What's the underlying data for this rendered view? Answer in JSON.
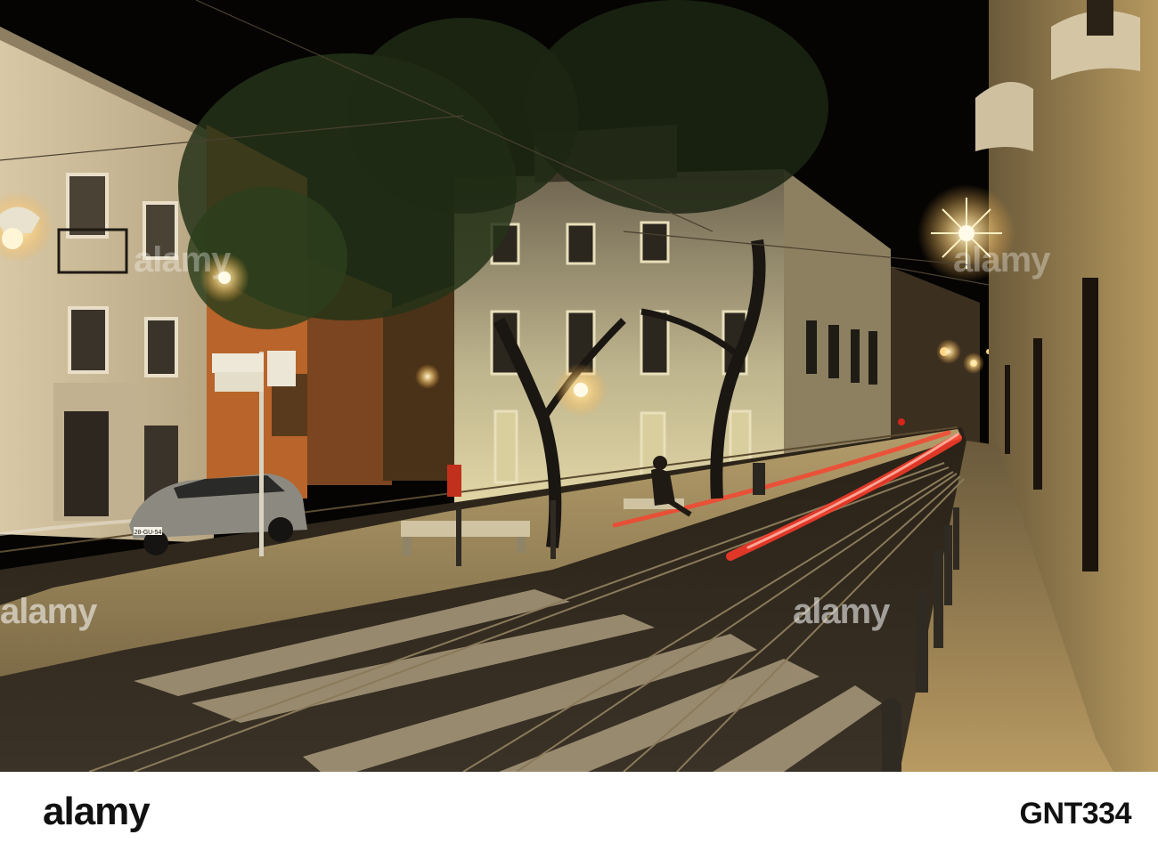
{
  "photo": {
    "watermarks": [
      "alamy",
      "alamy",
      "alamy",
      "alamy"
    ],
    "plate": "28-GU-54"
  },
  "footer": {
    "brand": "alamy",
    "image_id": "GNT334"
  },
  "colors": {
    "night_sky": "#050403",
    "lamp_glow": "#ffd98a",
    "light_trail": "#ff3b2a",
    "facade_warm": "#c9b07a",
    "cobblestone": "#8a7550"
  }
}
